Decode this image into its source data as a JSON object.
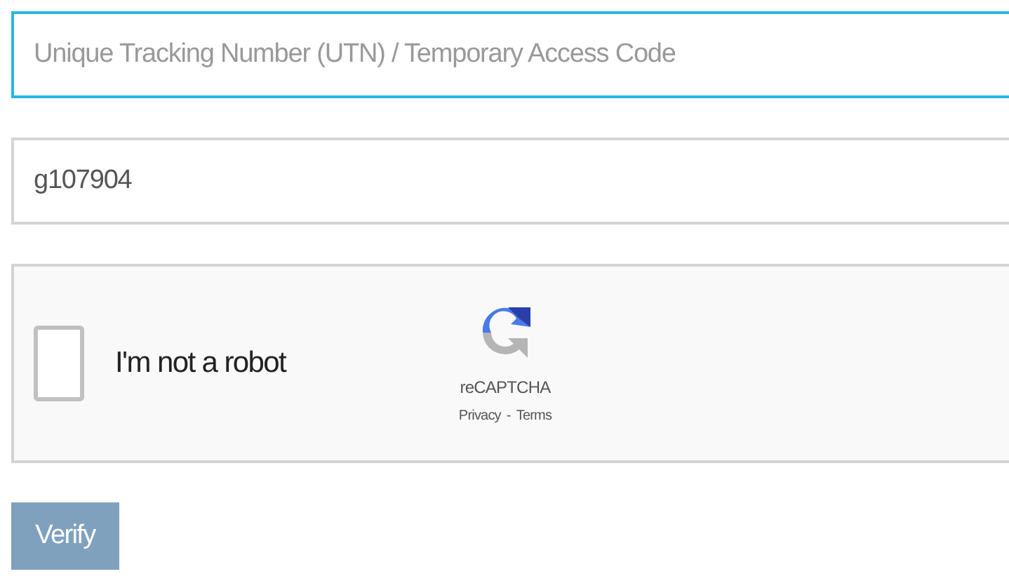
{
  "fields": [
    {
      "placeholder": "Unique Tracking Number (UTN) / Temporary Access Code",
      "focused": true
    },
    {
      "value": "g107904",
      "focused": false
    }
  ],
  "captcha": {
    "label": "I'm not a robot",
    "checked": false,
    "brand": "reCAPTCHA",
    "privacy_link": "Privacy",
    "separator": "-",
    "terms_link": "Terms"
  },
  "verify_button": {
    "label": "Verify",
    "disabled": true
  }
}
